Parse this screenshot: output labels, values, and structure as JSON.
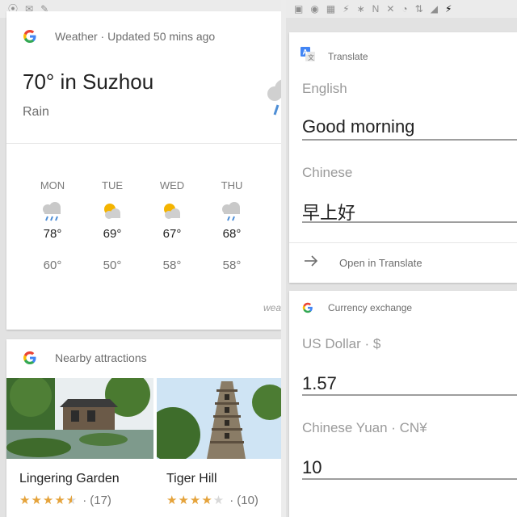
{
  "left_status": [
    "⦿",
    "✉",
    "✎"
  ],
  "right_status": [
    "▣",
    "◉",
    "▦",
    "⚡",
    "∗",
    "N",
    "✕",
    "◔",
    "⇅",
    "◢",
    "⚡"
  ],
  "colors": {
    "accent_rain": "#4f8fd6",
    "sun": "#f4b400",
    "stars": "#e5a33b"
  },
  "weather": {
    "header": "Weather · Updated 50 mins ago",
    "title": "70° in Suzhou",
    "condition": "Rain",
    "more_text": "wea",
    "days": [
      {
        "name": "MON",
        "icon": "rain-icon",
        "high": "78°",
        "low": "60°"
      },
      {
        "name": "TUE",
        "icon": "partly-sunny-icon",
        "high": "69°",
        "low": "50°"
      },
      {
        "name": "WED",
        "icon": "partly-sunny-icon",
        "high": "67°",
        "low": "58°"
      },
      {
        "name": "THU",
        "icon": "rain-icon",
        "high": "68°",
        "low": "58°"
      }
    ]
  },
  "attractions": {
    "header": "Nearby attractions",
    "items": [
      {
        "name": "Lingering Garden",
        "stars": 4.5,
        "count": "(17)",
        "icon": "garden-photo"
      },
      {
        "name": "Tiger Hill",
        "stars": 4,
        "count": "(10)",
        "icon": "pagoda-photo"
      }
    ]
  },
  "translate": {
    "header": "Translate",
    "source_lang": "English",
    "source_text": "Good morning",
    "target_lang": "Chinese",
    "target_text": "早上好",
    "open_label": "Open in Translate"
  },
  "currency": {
    "header": "Currency exchange",
    "from_label": "US Dollar · $",
    "from_value": "1.57",
    "to_label": "Chinese Yuan · CN¥",
    "to_value": "10"
  },
  "rating_separator": "·"
}
